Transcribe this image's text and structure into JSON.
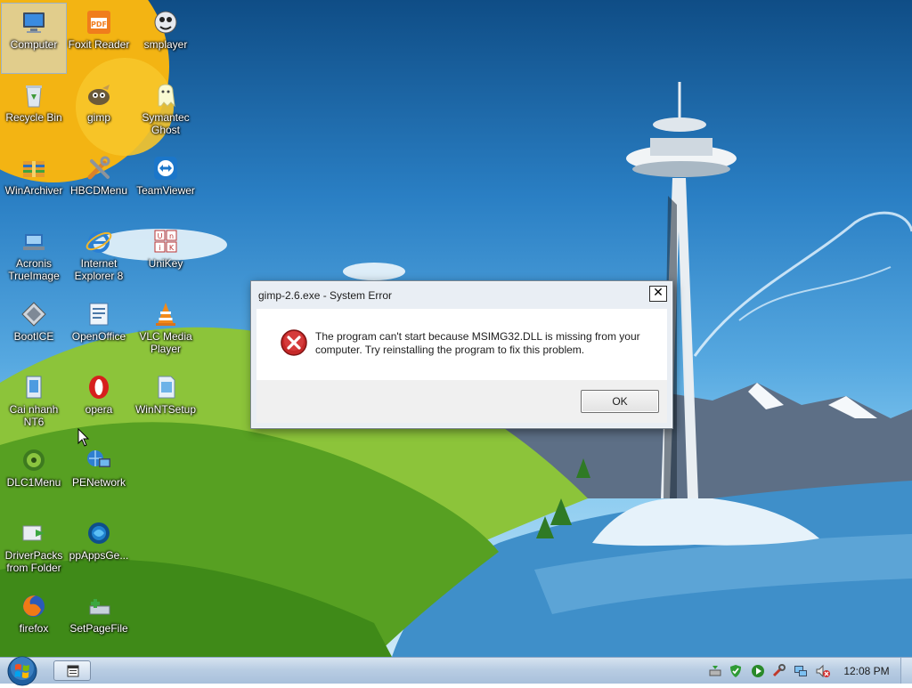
{
  "desktop": {
    "icons": [
      {
        "label": "Computer",
        "icon": "computer-icon",
        "selected": true
      },
      {
        "label": "Foxit Reader",
        "icon": "pdf-reader-icon"
      },
      {
        "label": "smplayer",
        "icon": "media-player-icon"
      },
      {
        "label": "Recycle Bin",
        "icon": "recycle-bin-icon"
      },
      {
        "label": "gimp",
        "icon": "gimp-icon"
      },
      {
        "label": "Symantec Ghost",
        "icon": "ghost-icon"
      },
      {
        "label": "WinArchiver",
        "icon": "archive-icon"
      },
      {
        "label": "HBCDMenu",
        "icon": "tools-icon"
      },
      {
        "label": "TeamViewer",
        "icon": "teamviewer-icon"
      },
      {
        "label": "Acronis TrueImage",
        "icon": "backup-icon"
      },
      {
        "label": "Internet Explorer 8",
        "icon": "internet-explorer-icon"
      },
      {
        "label": "UniKey",
        "icon": "keyboard-icon"
      },
      {
        "label": "BootICE",
        "icon": "boot-tool-icon"
      },
      {
        "label": "OpenOffice",
        "icon": "office-icon"
      },
      {
        "label": "VLC Media Player",
        "icon": "vlc-cone-icon"
      },
      {
        "label": "Cai nhanh NT6",
        "icon": "installer-icon"
      },
      {
        "label": "opera",
        "icon": "opera-icon"
      },
      {
        "label": "WinNTSetup",
        "icon": "setup-icon"
      },
      {
        "label": "DLC1Menu",
        "icon": "dlc-disc-icon"
      },
      {
        "label": "PENetwork",
        "icon": "network-icon"
      },
      {
        "label": "DriverPacks from Folder",
        "icon": "driver-pack-icon"
      },
      {
        "label": "ppAppsGe...",
        "icon": "apps-globe-icon"
      },
      {
        "label": "firefox",
        "icon": "firefox-icon"
      },
      {
        "label": "SetPageFile",
        "icon": "pagefile-icon"
      }
    ]
  },
  "dialog": {
    "title": "gimp-2.6.exe - System Error",
    "close_label": "✕",
    "icon": "error-icon",
    "message": "The program can't start because MSIMG32.DLL is missing from your computer. Try reinstalling the program to fix this problem.",
    "ok_label": "OK"
  },
  "taskbar": {
    "start_icon": "windows-start-icon",
    "task_icon": "console-window-icon",
    "tray_icons": [
      "safely-remove-icon",
      "security-check-icon",
      "play-icon",
      "tool-icon",
      "network-monitor-icon",
      "volume-muted-icon"
    ],
    "clock": "12:08 PM"
  }
}
